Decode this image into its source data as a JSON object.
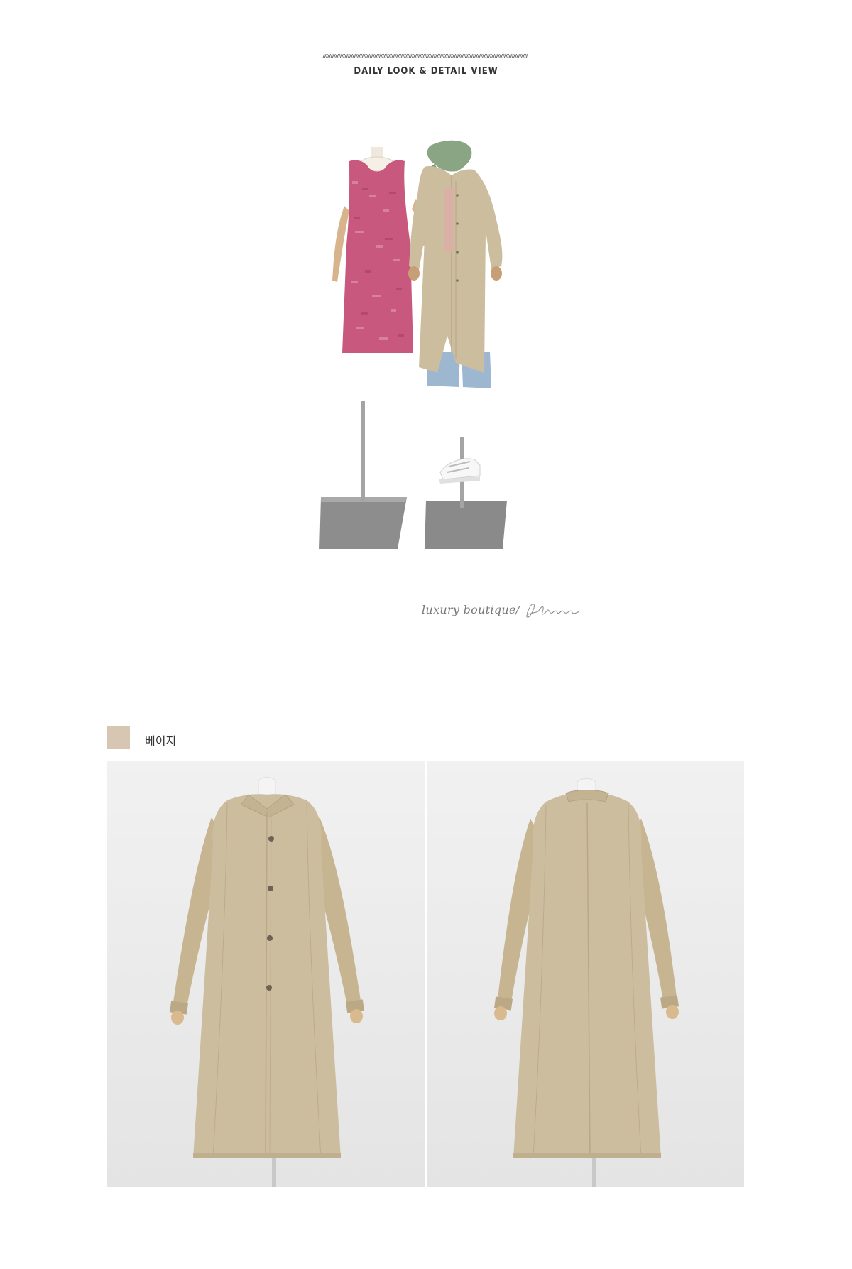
{
  "header": {
    "title": "DAILY LOOK & DETAIL VIEW"
  },
  "signature": {
    "text": "luxury boutique",
    "brand_mark": "J.blanc"
  },
  "color_option": {
    "swatch_color": "#d7c6b2",
    "label": "베이지"
  },
  "colors": {
    "tweed_pink": "#c9587e",
    "coat_beige": "#cdbd9f",
    "scarf_green": "#8aa583",
    "denim_blue": "#9db7d0",
    "photo_bg": "#ececec"
  }
}
